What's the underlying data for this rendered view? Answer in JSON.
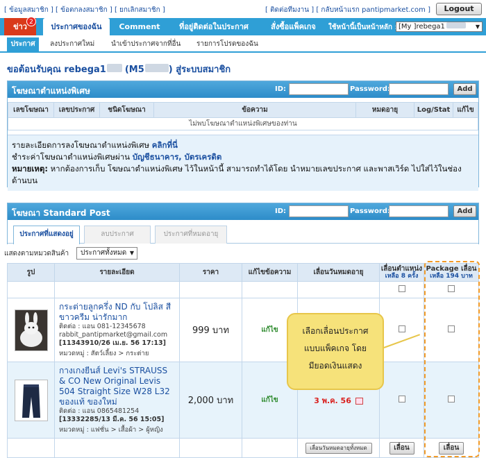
{
  "toplinks": {
    "left": "[ ข้อมูลสมาชิก ] [ ข้อตกลงสมาชิก ] [ ยกเลิกสมาชิก ]",
    "right": "[ ติดต่อทีมงาน ] [ กลับหน้าแรก pantipmarket.com ]",
    "logout": "Logout"
  },
  "tabs": {
    "news": "ข่าว",
    "news_badge": "2",
    "my_ads": "ประกาศของฉัน",
    "comment": "Comment",
    "contacted": "ที่อยู่ติดต่อในประกาศ",
    "order_package": "สั่งซื้อแพ็คเกจ",
    "home_label": "ใช้หน้านี้เป็นหน้าหลัก :",
    "home_value": "[My ]rebega1"
  },
  "subtabs": [
    "ประกาศ",
    "ลงประกาศใหม่",
    "นำเข้าประกาศจากที่อื่น",
    "รายการโปรดของฉัน"
  ],
  "welcome": {
    "prefix": "ขอต้อนรับคุณ rebega1",
    "mid": "(M5",
    "suffix": ") สู่ระบบสมาชิก"
  },
  "special": {
    "title": "โฆษณาตำแหน่งพิเศษ",
    "id_label": "ID:",
    "password_label": "Password:",
    "add_label": "Add",
    "columns": [
      "เลขโฆษณา",
      "เลขประกาศ",
      "ชนิดโฆษณา",
      "ข้อความ",
      "หมดอายุ",
      "Log/Stat",
      "แก้ไข"
    ],
    "empty": "ไม่พบโฆษณาตำแหน่งพิเศษของท่าน",
    "info_line1": "รายละเอียดการลงโฆษณาตำแหน่งพิเศษ ",
    "info_line1_link": "คลิกที่นี่",
    "info_line2": "ชำระค่าโฆษณาตำแหน่งพิเศษผ่าน ",
    "info_line2_link": "บัญชีธนาคาร, บัตรเครดิต",
    "info_line3_bold": "หมายเหตุ:",
    "info_line3": " หากต้องการเก็บ โฆษณาตำแหน่งพิเศษ ไว้ในหน้านี้ สามารถทำได้โดย นำหมายเลขประกาศ และพาสเวิร์ด ไปใส่ไว้ในช่องด้านบน"
  },
  "standard": {
    "title": "โฆษณา Standard Post",
    "id_label": "ID:",
    "password_label": "Password:",
    "add_label": "Add",
    "tabs": [
      "ประกาศที่แสดงอยู่",
      "ลบประกาศ",
      "ประกาศที่หมดอายุ"
    ],
    "filter_label": "แสดงตามหมวดสินค้า",
    "filter_value": "ประกาศทั้งหมด",
    "columns": {
      "image": "รูป",
      "detail": "รายละเอียด",
      "price": "ราคา",
      "edit": "แก้ไขข้อความ",
      "expire": "เลื่อนวันหมดอายุ",
      "slide_pos": "เลื่อนตำแหน่ง",
      "slide_pos_sub": "เหลือ 8 ครั้ง",
      "package": "Package เลื่อน",
      "package_sub": "เหลือ 194 บาท"
    },
    "rows": [
      {
        "title": "กระต่ายลูกครึ่ง ND กับ โปลิส สี ขาวครีม น่ารักมาก",
        "contact": "ติดต่อ : แอน 081-12345678",
        "email": "rabbit_pantipmarket@gmail.com",
        "id_date": "[11343910/26 เม.ย. 56 17:13]",
        "category": "หมวดหมู่ : สัตว์เลี้ยง > กระต่าย",
        "price": "999 บาท",
        "edit": "แก้ไข",
        "expire": ""
      },
      {
        "title": "กางเกงยีนส์ Levi's STRAUSS & CO New Original Levis 504 Straight Size W28 L32 ของแท้ ของใหม่",
        "contact": "ติดต่อ : แอน 0865481254",
        "email": "",
        "id_date": "[13332285/13 มี.ค. 56 15:05]",
        "category": "หมวดหมู่ : แฟชั่น > เสื้อผ้า > ผู้หญิง",
        "price": "2,000 บาท",
        "edit": "แก้ไข",
        "expire": "3 พ.ค. 56"
      }
    ],
    "expire_all_button": "เลื่อนวันหมดอายุทั้งหมด",
    "slide_button": "เลื่อน",
    "package_button": "เลื่อน"
  },
  "callout": {
    "line1": "เลือกเลื่อนประกาศ",
    "line2": "แบบแพ็คเกจ โดย",
    "line3": "มียอดเงินแสดง"
  },
  "colors": {
    "tab_bar": "#2f9fd6",
    "link": "#1a4fa0",
    "callout": "#f6e27a",
    "highlight": "#f29a26"
  }
}
